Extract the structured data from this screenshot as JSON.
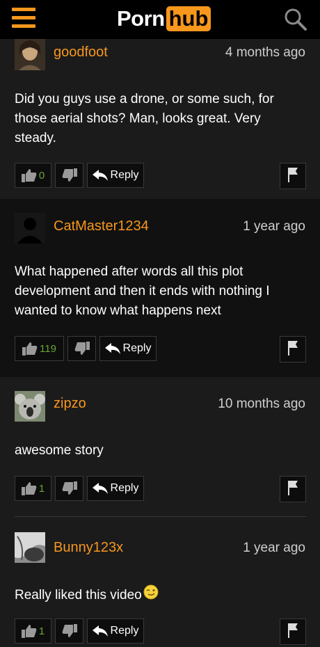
{
  "header": {
    "logo_left": "Porn",
    "logo_right": "hub"
  },
  "colors": {
    "accent": "#f7971d",
    "vote_count": "#6aa434",
    "background": "#1b1b1b"
  },
  "comments": [
    {
      "user": "goodfoot",
      "time": "4 months ago",
      "text": "Did you guys use a drone, or some such, for those aerial shots? Man, looks great. Very steady.",
      "likes": "0",
      "reply_label": "Reply",
      "avatar": "portrait-avatar"
    },
    {
      "user": "CatMaster1234",
      "time": "1 year ago",
      "text": "What happened after words all this plot development and then it ends with nothing I wanted to know what happens next",
      "likes": "119",
      "reply_label": "Reply",
      "avatar": "default-silhouette-avatar"
    },
    {
      "user": "zipzo",
      "time": "10 months ago",
      "text": "awesome story",
      "likes": "1",
      "reply_label": "Reply",
      "avatar": "koala-avatar"
    },
    {
      "user": "Bunny123x",
      "time": "1 year ago",
      "text": "Really liked this video",
      "likes": "1",
      "reply_label": "Reply",
      "avatar": "grayscale-photo-avatar",
      "emoji": "wink-emoji"
    }
  ]
}
